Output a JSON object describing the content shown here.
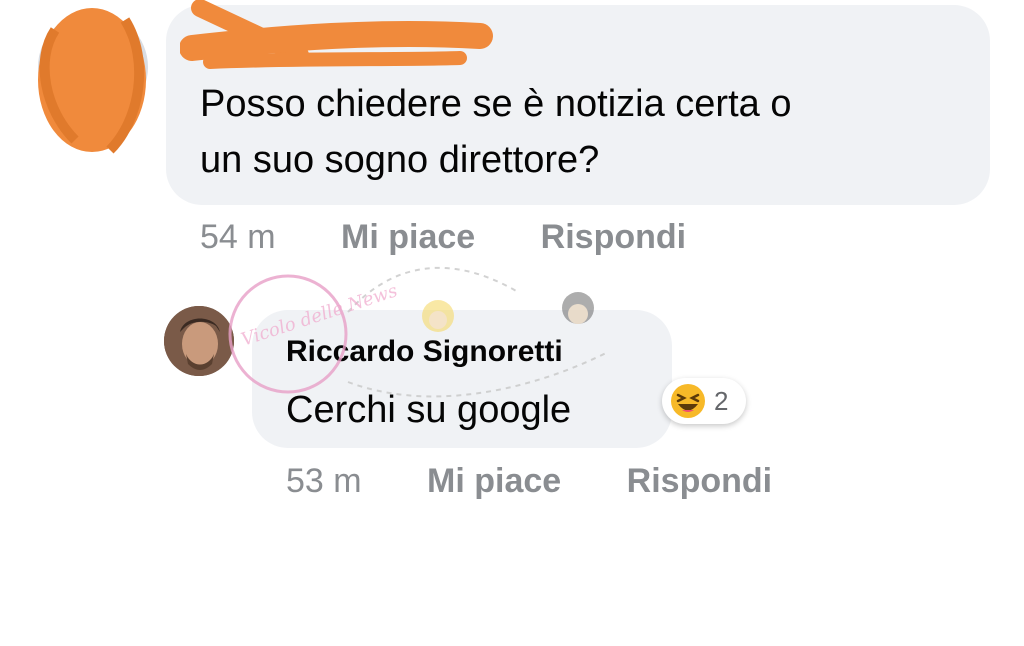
{
  "comment1": {
    "author": "",
    "text_line1": "Posso chiedere se è notizia certa o",
    "text_line2": "un suo sogno direttore?",
    "time": "54 m",
    "like_label": "Mi piace",
    "reply_label": "Rispondi"
  },
  "comment2": {
    "author": "Riccardo Signoretti",
    "text": "Cerchi su google",
    "time": "53 m",
    "like_label": "Mi piace",
    "reply_label": "Rispondi",
    "reaction": {
      "icon": "laughing-emoji-icon",
      "count": "2"
    }
  },
  "watermark": {
    "text": "Vicolo delle News"
  },
  "colors": {
    "bubble": "#f0f2f5",
    "meta_text": "#8a8d91",
    "scribble": "#f08a3c",
    "emoji_yellow": "#f7b928"
  }
}
